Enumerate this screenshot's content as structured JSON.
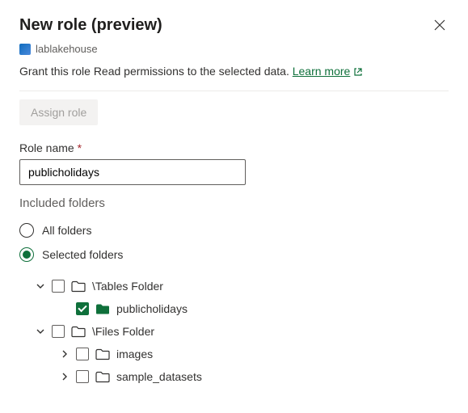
{
  "header": {
    "title": "New role (preview)",
    "context_name": "lablakehouse"
  },
  "description": {
    "text": "Grant this role Read permissions to the selected data.",
    "link_text": "Learn more"
  },
  "actions": {
    "assign_label": "Assign role"
  },
  "form": {
    "role_name_label": "Role name",
    "role_name_value": "publicholidays",
    "included_label": "Included folders",
    "radio_all": "All folders",
    "radio_selected": "Selected folders"
  },
  "tree": {
    "tables_folder": "\\Tables Folder",
    "publicholidays": "publicholidays",
    "files_folder": "\\Files Folder",
    "images": "images",
    "sample_datasets": "sample_datasets"
  }
}
